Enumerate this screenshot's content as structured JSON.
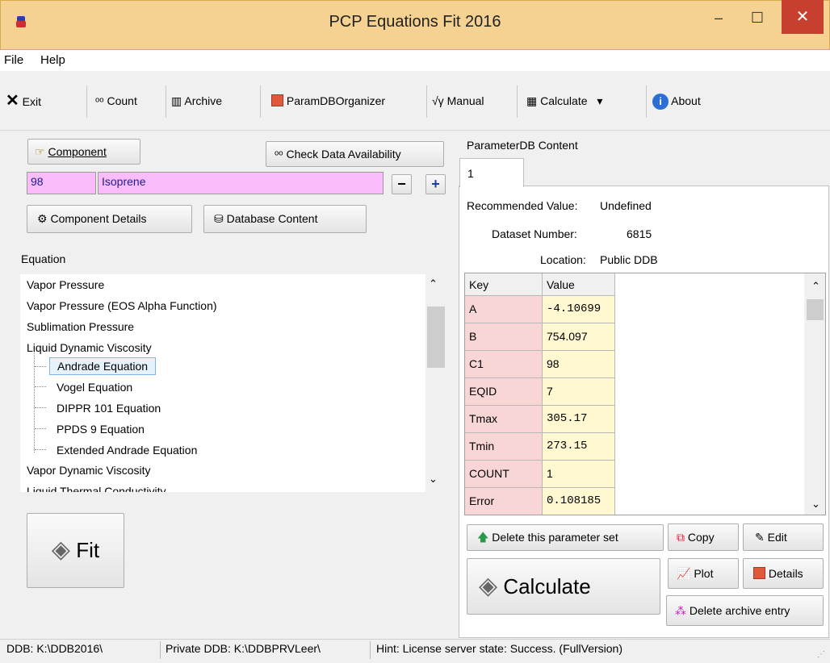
{
  "window": {
    "title": "PCP Equations Fit 2016",
    "min": "–",
    "max": "☐",
    "close": "✕"
  },
  "menu": [
    "File",
    "Help"
  ],
  "toolbar": {
    "exit": "Exit",
    "count": "Count",
    "archive": "Archive",
    "paramdb": "ParamDBOrganizer",
    "manual": "Manual",
    "calculate": "Calculate",
    "about": "About"
  },
  "left": {
    "component_btn": "Component",
    "check_btn": "Check Data Availability",
    "comp_number": "98",
    "comp_name": "Isoprene",
    "details_btn": "Component Details",
    "dbcontent_btn": "Database Content",
    "equation_label": "Equation",
    "tree": [
      "Vapor Pressure",
      "Vapor Pressure (EOS Alpha Function)",
      "Sublimation Pressure",
      "Liquid Dynamic Viscosity",
      "Andrade Equation",
      "Vogel Equation",
      "DIPPR 101 Equation",
      "PPDS 9 Equation",
      "Extended Andrade Equation",
      "Vapor Dynamic Viscosity",
      "Liquid Thermal Conductivity"
    ],
    "fit_btn": "Fit"
  },
  "right": {
    "title": "ParameterDB Content",
    "tab": "1",
    "recommended_label": "Recommended Value:",
    "recommended_value": "Undefined",
    "dataset_label": "Dataset Number:",
    "dataset_value": "6815",
    "location_label": "Location:",
    "location_value": "Public DDB",
    "grid_headers": [
      "Key",
      "Value"
    ],
    "rows": [
      [
        "A",
        "-4.10699"
      ],
      [
        "B",
        "754.097"
      ],
      [
        "C1",
        "98"
      ],
      [
        "EQID",
        "7"
      ],
      [
        "Tmax",
        "305.17"
      ],
      [
        "Tmin",
        "273.15"
      ],
      [
        "COUNT",
        "1"
      ],
      [
        "Error",
        "0.108185"
      ]
    ],
    "delete_param_btn": "Delete this parameter set",
    "copy_btn": "Copy",
    "edit_btn": "Edit",
    "plot_btn": "Plot",
    "details_btn": "Details",
    "calculate_btn": "Calculate",
    "delete_archive_btn": "Delete archive entry"
  },
  "status": {
    "ddb": "DDB:  K:\\DDB2016\\",
    "private": "Private DDB:  K:\\DDBPRVLeer\\",
    "hint": "Hint:  License server state: Success. (FullVersion)"
  },
  "colors": {
    "titlebar": "#f5d291",
    "close": "#c7402f",
    "pink": "#fbbcfb",
    "keycell": "#f9d6d6",
    "valcell": "#fff8d0"
  }
}
